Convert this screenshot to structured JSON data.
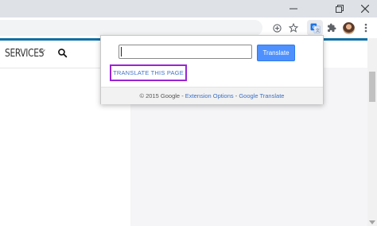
{
  "window_controls": {
    "minimize_icon": "minimize-icon",
    "restore_icon": "restore-icon",
    "close_icon": "close-icon"
  },
  "toolbar": {
    "icons": [
      "add-circle-icon",
      "star-icon",
      "google-translate-extension-icon",
      "puzzle-extensions-icon",
      "profile-avatar",
      "kebab-menu-icon"
    ],
    "active_extension_color": "#1a73e8"
  },
  "site": {
    "nav_services": "SERVICES",
    "accent_color": "#0f6fa5"
  },
  "translate_popup": {
    "input_value": "",
    "translate_button": "Translate",
    "translate_page_link": "TRANSLATE THIS PAGE",
    "highlight_color": "#9a24d6",
    "footer_copyright": "© 2015 Google",
    "footer_sep1": " - ",
    "footer_extension_options": "Extension Options",
    "footer_sep2": " - ",
    "footer_google_translate": "Google Translate"
  }
}
